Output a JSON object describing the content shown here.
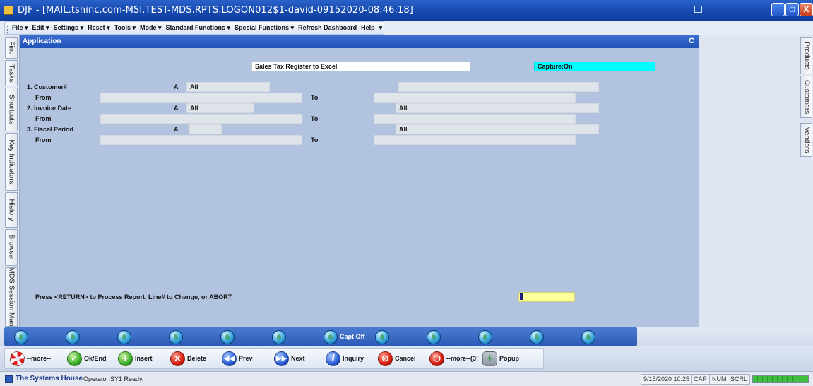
{
  "window": {
    "title": "DJF - [MAIL.tshinc.com-MSI.TEST-MDS.RPTS.LOGON012$1-david-09152020-08:46:18]",
    "buttons": {
      "minimize": "_",
      "maximize": "□",
      "close": "X"
    }
  },
  "menu": {
    "items": [
      "File ▾",
      "Edit ▾",
      "Settings ▾",
      "Reset ▾",
      "Tools ▾",
      "Mode ▾",
      "Standard Functions ▾",
      "Special Functions ▾",
      "Refresh Dashboard",
      "Help",
      "▾"
    ]
  },
  "left_tabs": [
    "Find",
    "Tasks",
    "Shortcuts",
    "Key Indicators",
    "History",
    "Browser",
    "MDS Session Man"
  ],
  "right_tabs": [
    "Products",
    "Customers",
    "Vendors"
  ],
  "panel": {
    "title": "Application",
    "refresh_icon": "C"
  },
  "form": {
    "report_title": "Sales Tax Register to Excel",
    "capture": "Capture:On",
    "rows": [
      {
        "label": "1. Customer#",
        "mode": "A",
        "value": "All",
        "range_value": "",
        "from": "From",
        "to": "To"
      },
      {
        "label": "2. Invoice Date",
        "mode": "A",
        "value": "All",
        "range_value": "All",
        "from": "From",
        "to": "To"
      },
      {
        "label": "3. Fiscal Period",
        "mode": "A",
        "value": "",
        "range_value": "All",
        "from": "From",
        "to": "To"
      }
    ],
    "prompt": "Press <RETURN> to Process Report, Line# to Change, or ABORT"
  },
  "function_bar": {
    "capt_label": "Capt Off"
  },
  "action_bar": {
    "buttons": [
      {
        "label": "--more--",
        "icon": "lifering-icon"
      },
      {
        "label": "Ok/End",
        "icon": "checkmark-icon"
      },
      {
        "label": "Insert",
        "icon": "plus-icon"
      },
      {
        "label": "Delete",
        "icon": "x-icon"
      },
      {
        "label": "Prev",
        "icon": "rewind-icon"
      },
      {
        "label": "Next",
        "icon": "fast-forward-icon"
      },
      {
        "label": "Inquiry",
        "icon": "info-icon"
      },
      {
        "label": "Cancel",
        "icon": "no-entry-icon"
      },
      {
        "label": "--more--(3!",
        "icon": "power-icon"
      },
      {
        "label": "Popup",
        "icon": "database-add-icon"
      }
    ]
  },
  "status": {
    "company": "The Systems House",
    "operator": "Operator:SY1 Ready.",
    "datetime": "9/15/2020 10:25",
    "cap": "CAP",
    "num": "NUM",
    "scrl": "SCRL",
    "progress": 1.0
  },
  "colors": {
    "title_bar": "#1a4eb4",
    "panel_bg": "#b2c3df",
    "capture_bg": "#00ffff",
    "input_active": "#ffff99"
  }
}
